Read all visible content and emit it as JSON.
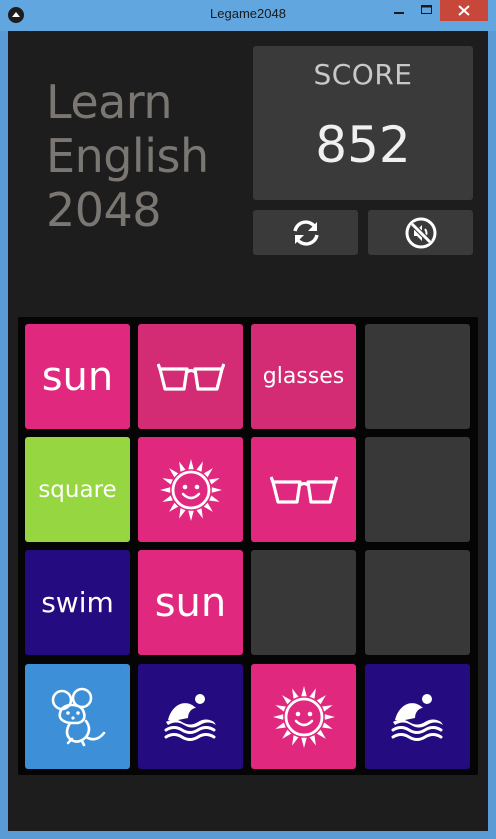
{
  "window": {
    "title": "Legame2048"
  },
  "header": {
    "title_lines": [
      "Learn",
      "English",
      "2048"
    ]
  },
  "score": {
    "label": "SCORE",
    "value": "852"
  },
  "controls": {
    "restart_icon": "refresh-icon",
    "sound_icon": "sound-off-icon"
  },
  "colors": {
    "background": "#1d1d1d",
    "board": "#050505",
    "panel": "#3a3a3a",
    "empty_tile": "#383838",
    "pink": "#e0287e",
    "pink_dark": "#d42b75",
    "green": "#96d640",
    "navy": "#250b80",
    "blue": "#3d8fd8",
    "title_text": "#7a7672"
  },
  "board": {
    "tiles": [
      {
        "row": 0,
        "col": 0,
        "kind": "word",
        "text": "sun",
        "color": "#e0287e"
      },
      {
        "row": 0,
        "col": 1,
        "kind": "icon",
        "icon": "glasses-icon",
        "color": "#d42b75"
      },
      {
        "row": 0,
        "col": 2,
        "kind": "word",
        "text": "glasses",
        "color": "#d42b75"
      },
      {
        "row": 0,
        "col": 3,
        "kind": "empty"
      },
      {
        "row": 1,
        "col": 0,
        "kind": "word",
        "text": "square",
        "color": "#96d640"
      },
      {
        "row": 1,
        "col": 1,
        "kind": "icon",
        "icon": "sun-icon",
        "color": "#e0287e"
      },
      {
        "row": 1,
        "col": 2,
        "kind": "icon",
        "icon": "glasses-icon",
        "color": "#e0287e"
      },
      {
        "row": 1,
        "col": 3,
        "kind": "empty"
      },
      {
        "row": 2,
        "col": 0,
        "kind": "word",
        "text": "swim",
        "color": "#250b80"
      },
      {
        "row": 2,
        "col": 1,
        "kind": "word",
        "text": "sun",
        "color": "#e0287e"
      },
      {
        "row": 2,
        "col": 2,
        "kind": "empty"
      },
      {
        "row": 2,
        "col": 3,
        "kind": "empty"
      },
      {
        "row": 3,
        "col": 0,
        "kind": "icon",
        "icon": "mouse-icon",
        "color": "#3d8fd8"
      },
      {
        "row": 3,
        "col": 1,
        "kind": "icon",
        "icon": "swimmer-icon",
        "color": "#250b80"
      },
      {
        "row": 3,
        "col": 2,
        "kind": "icon",
        "icon": "sun-icon",
        "color": "#e0287e"
      },
      {
        "row": 3,
        "col": 3,
        "kind": "icon",
        "icon": "swimmer-icon",
        "color": "#250b80"
      }
    ]
  }
}
